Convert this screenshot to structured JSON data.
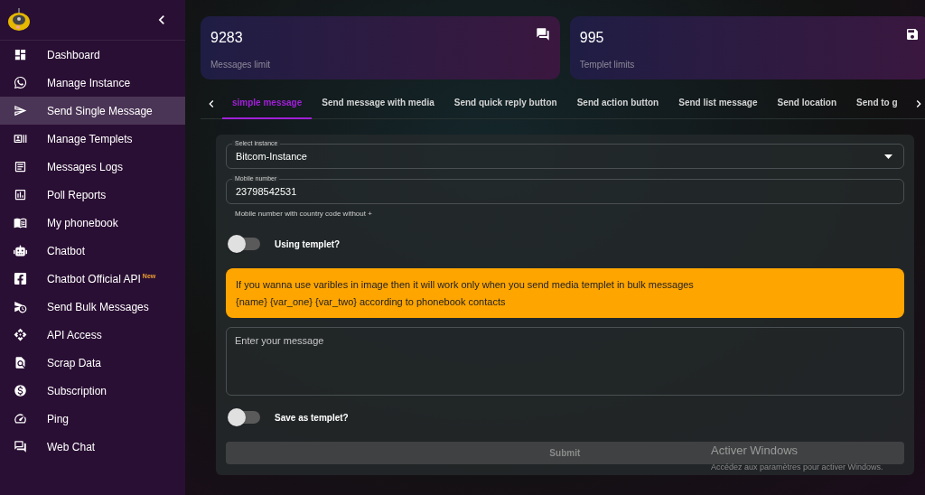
{
  "sidebar": {
    "items": [
      {
        "label": "Dashboard",
        "selected": false
      },
      {
        "label": "Manage Instance",
        "selected": false
      },
      {
        "label": "Send Single Message",
        "selected": true
      },
      {
        "label": "Manage Templets",
        "selected": false
      },
      {
        "label": "Messages Logs",
        "selected": false
      },
      {
        "label": "Poll Reports",
        "selected": false
      },
      {
        "label": "My phonebook",
        "selected": false
      },
      {
        "label": "Chatbot",
        "selected": false
      },
      {
        "label": "Chatbot Official API",
        "selected": false,
        "badge": "New"
      },
      {
        "label": "Send Bulk Messages",
        "selected": false
      },
      {
        "label": "API Access",
        "selected": false
      },
      {
        "label": "Scrap Data",
        "selected": false
      },
      {
        "label": "Subscription",
        "selected": false
      },
      {
        "label": "Ping",
        "selected": false
      },
      {
        "label": "Web Chat",
        "selected": false
      }
    ]
  },
  "stats": [
    {
      "value": "9283",
      "label": "Messages limit"
    },
    {
      "value": "995",
      "label": "Templet limits"
    }
  ],
  "tabs": [
    {
      "label": "simple message",
      "selected": true
    },
    {
      "label": "Send message with media",
      "selected": false
    },
    {
      "label": "Send quick reply button",
      "selected": false
    },
    {
      "label": "Send action button",
      "selected": false
    },
    {
      "label": "Send list message",
      "selected": false
    },
    {
      "label": "Send location",
      "selected": false
    },
    {
      "label": "Send to g",
      "selected": false
    }
  ],
  "form": {
    "instance": {
      "label": "Select instance",
      "value": "Bitcom-Instance"
    },
    "mobile": {
      "label": "Mobile number",
      "value": "23798542531",
      "helper": "Mobile number with country code without +"
    },
    "using_templet": {
      "label": "Using templet?",
      "on": false
    },
    "notice": [
      "If you wanna use varibles in image then it will work only when you send media templet in bulk messages",
      "{name} {var_one} {var_two} according to phonebook contacts"
    ],
    "message": {
      "placeholder": "Enter your message"
    },
    "save_templet": {
      "label": "Save as templet?",
      "on": false
    },
    "submit": "Submit"
  },
  "os_notice": {
    "title": "Activer Windows",
    "text": "Accédez aux paramètres pour activer Windows."
  }
}
